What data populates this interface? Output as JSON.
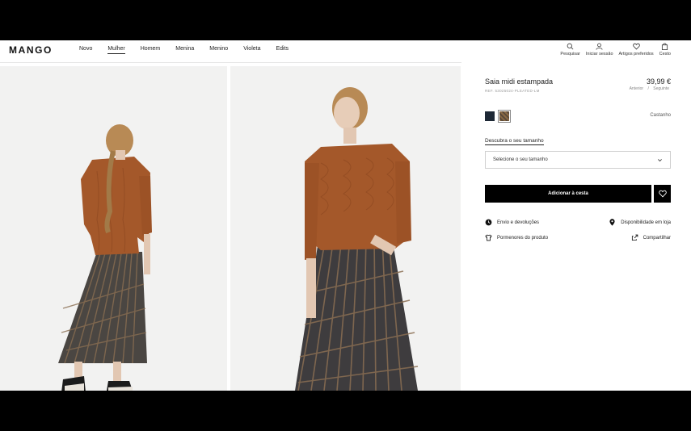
{
  "header": {
    "logo": "MANGO",
    "nav": [
      {
        "label": "Novo",
        "active": false
      },
      {
        "label": "Mulher",
        "active": true
      },
      {
        "label": "Homem",
        "active": false
      },
      {
        "label": "Menina",
        "active": false
      },
      {
        "label": "Menino",
        "active": false
      },
      {
        "label": "Violeta",
        "active": false
      },
      {
        "label": "Edits",
        "active": false
      }
    ],
    "actions": {
      "search": "Pesquisar",
      "login": "Iniciar sessão",
      "wishlist": "Artigos preferidos",
      "cart": "Cesto"
    }
  },
  "breadcrumb": {
    "prev": "Anterior",
    "sep": "/",
    "next": "Seguinte"
  },
  "product": {
    "title": "Saia midi estampada",
    "price": "39,99 €",
    "ref": "REF. 53025024-PLEATED-LM",
    "color_name": "Castanho",
    "size_guide": "Descubra o seu tamanho",
    "size_placeholder": "Selecione o seu tamanho",
    "add_to_cart": "Adicionar à cesta"
  },
  "info": {
    "shipping": "Envio e devoluções",
    "store": "Disponibilidade em loja",
    "details": "Pormenores do produto",
    "share": "Compartilhar"
  },
  "colors": {
    "sweater": "#a4582a",
    "skirt_dark": "#3a3a3e",
    "skirt_light": "#8a6e52"
  }
}
